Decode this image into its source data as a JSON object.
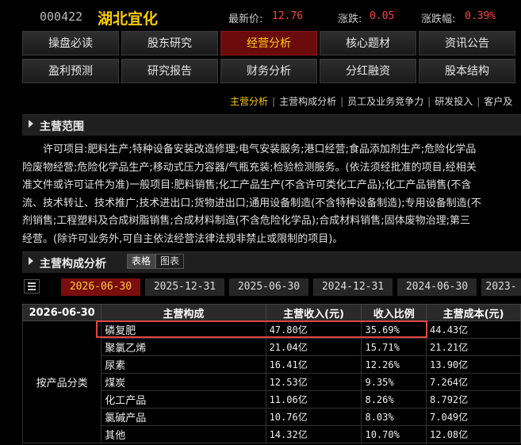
{
  "header": {
    "stock_code": "000422",
    "stock_name": "湖北宜化",
    "price_label": "最新价:",
    "price_value": "12.76",
    "change_label": "涨跌:",
    "change_value": "0.05",
    "pct_label": "涨跌幅:",
    "pct_value": "0.39%"
  },
  "nav": {
    "row1": [
      "操盘必读",
      "股东研究",
      "经营分析",
      "核心题材",
      "资讯公告"
    ],
    "row2": [
      "盈利预测",
      "研究报告",
      "财务分析",
      "分红融资",
      "股本结构"
    ],
    "active": "经营分析"
  },
  "subnav": {
    "items": [
      "主营分析",
      "主营构成分析",
      "员工及业务竞争力",
      "研发投入",
      "客户及"
    ],
    "active": "主营分析"
  },
  "scope": {
    "title": "主营范围",
    "lines": [
      "许可项目:肥料生产;特种设备安装改造修理;电气安装服务;港口经营;食品添加剂生产;危险化学品",
      "险废物经营;危险化学品生产;移动式压力容器/气瓶充装;检验检测服务。(依法须经批准的项目,经相关",
      "准文件或许可证件为准)一般项目:肥料销售;化工产品生产(不含许可类化工产品);化工产品销售(不含",
      "流、技术转让、技术推广;技术进出口;货物进出口;通用设备制造(不含特种设备制造);专用设备制造(不",
      "剂销售;工程塑料及合成树脂销售;合成材料制造(不含危险化学品);合成材料销售;固体废物治理;第三",
      "经营。(除许可业务外,可自主依法经营法律法规非禁止或限制的项目)。"
    ]
  },
  "composition": {
    "title": "主营构成分析",
    "view_table": "表格",
    "view_chart": "图表",
    "dates": [
      "2026-06-30",
      "2025-12-31",
      "2025-06-30",
      "2024-12-31",
      "2024-06-30",
      "2023-"
    ],
    "active_date": "2026-06-30",
    "columns": [
      "2026-06-30",
      "主营构成",
      "主营收入(元)",
      "收入比例",
      "主营成本(元)"
    ],
    "group_label": "按产品分类",
    "rows": [
      {
        "name": "磷复肥",
        "revenue": "47.80亿",
        "ratio": "35.69%",
        "cost": "44.43亿"
      },
      {
        "name": "聚氯乙烯",
        "revenue": "21.04亿",
        "ratio": "15.71%",
        "cost": "21.21亿"
      },
      {
        "name": "尿素",
        "revenue": "16.41亿",
        "ratio": "12.26%",
        "cost": "13.90亿"
      },
      {
        "name": "煤炭",
        "revenue": "12.53亿",
        "ratio": "9.35%",
        "cost": "7.264亿"
      },
      {
        "name": "化工产品",
        "revenue": "11.06亿",
        "ratio": "8.26%",
        "cost": "8.792亿"
      },
      {
        "name": "氯碱产品",
        "revenue": "10.76亿",
        "ratio": "8.03%",
        "cost": "7.049亿"
      },
      {
        "name": "其他",
        "revenue": "14.32亿",
        "ratio": "10.70%",
        "cost": "12.08亿"
      }
    ]
  },
  "colors": {
    "accent": "#ffcc00",
    "up": "#ff4040",
    "active_tab": "#6b0b0b",
    "highlight_box": "#e04545"
  }
}
